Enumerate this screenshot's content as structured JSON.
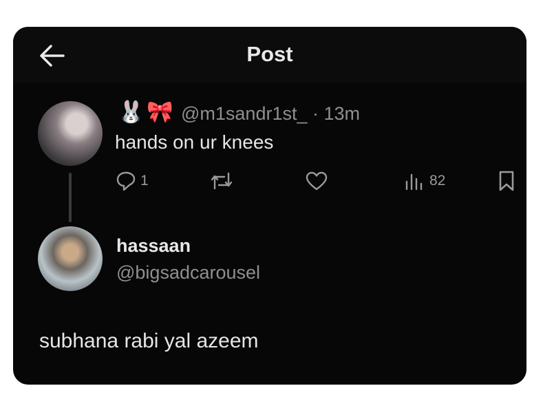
{
  "header": {
    "title": "Post",
    "back_icon": "arrow-left-icon"
  },
  "original_post": {
    "emojis": [
      "🐰",
      "🎀"
    ],
    "handle": "@m1sandr1st_",
    "time": "· 13m",
    "text": "hands on ur knees",
    "actions": {
      "reply_count": "1",
      "views_count": "82",
      "icons": [
        "reply-icon",
        "repost-icon",
        "like-icon",
        "views-icon",
        "bookmark-icon"
      ]
    }
  },
  "reply": {
    "name": "hassaan",
    "handle": "@bigsadcarousel",
    "text": "subhana rabi yal azeem"
  },
  "colors": {
    "background": "#070707",
    "text": "#e6e6e6",
    "muted": "#8f8f8f"
  }
}
